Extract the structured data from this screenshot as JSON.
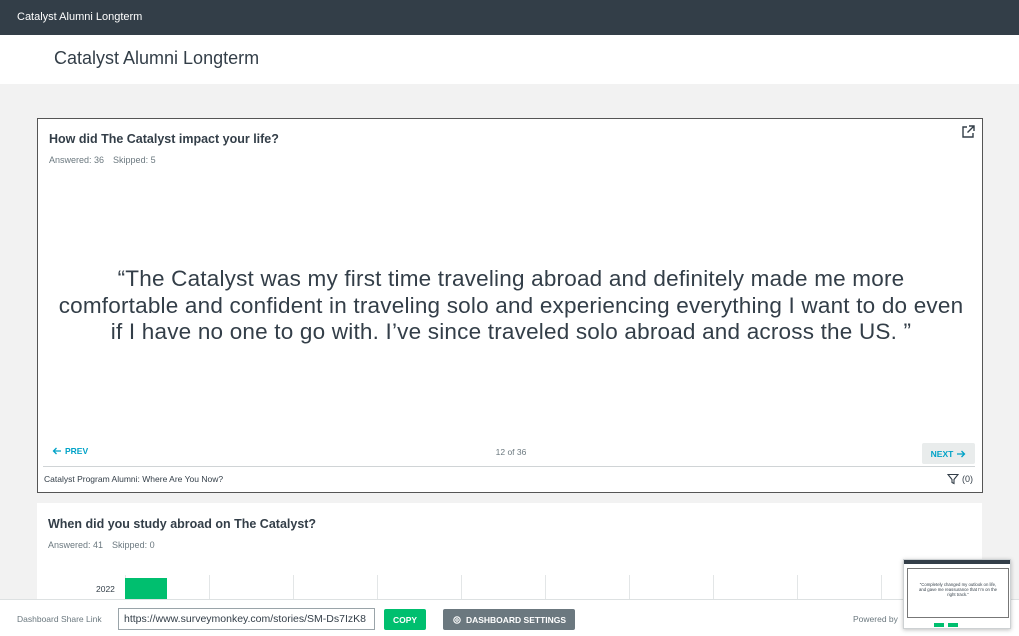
{
  "app": {
    "window_title": "Catalyst Alumni Longterm",
    "page_title": "Catalyst Alumni Longterm"
  },
  "question1": {
    "title": "How did The Catalyst impact your life?",
    "answered": "Answered: 36",
    "skipped": "Skipped: 5",
    "quote": "“The Catalyst was my first time traveling abroad and definitely made me more comfortable and confident in traveling solo and experiencing everything I want to do even if I have no one to go with. I’ve since traveled solo abroad and across the US. ”",
    "prev_label": "PREV",
    "next_label": "NEXT",
    "pager": "12 of 36",
    "survey_name": "Catalyst Program Alumni: Where Are You Now?",
    "filter_count": "(0)",
    "icons": [
      "external-link-icon",
      "arrow-left-icon",
      "arrow-right-icon",
      "filter-icon"
    ]
  },
  "question2": {
    "title": "When did you study abroad on The Catalyst?",
    "answered": "Answered: 41",
    "skipped": "Skipped: 0",
    "chart_data": {
      "type": "bar",
      "orientation": "horizontal",
      "categories": [
        "2022"
      ],
      "values": [
        0.05
      ],
      "color": "#00bf6f"
    }
  },
  "bottombar": {
    "share_label": "Dashboard Share Link",
    "share_url": "https://www.surveymonkey.com/stories/SM-Ds7IzK8",
    "copy_label": "COPY",
    "settings_label": "DASHBOARD SETTINGS",
    "powered_by": "Powered by"
  },
  "thumbnail": {
    "quote": "“Completely changed my outlook on life, and gave me reassurance that I’m on the right track.”"
  },
  "colors": {
    "topbar": "#333e48",
    "accent": "#00bf6f",
    "link": "#00a2c7",
    "neutral_button": "#6b787f"
  }
}
